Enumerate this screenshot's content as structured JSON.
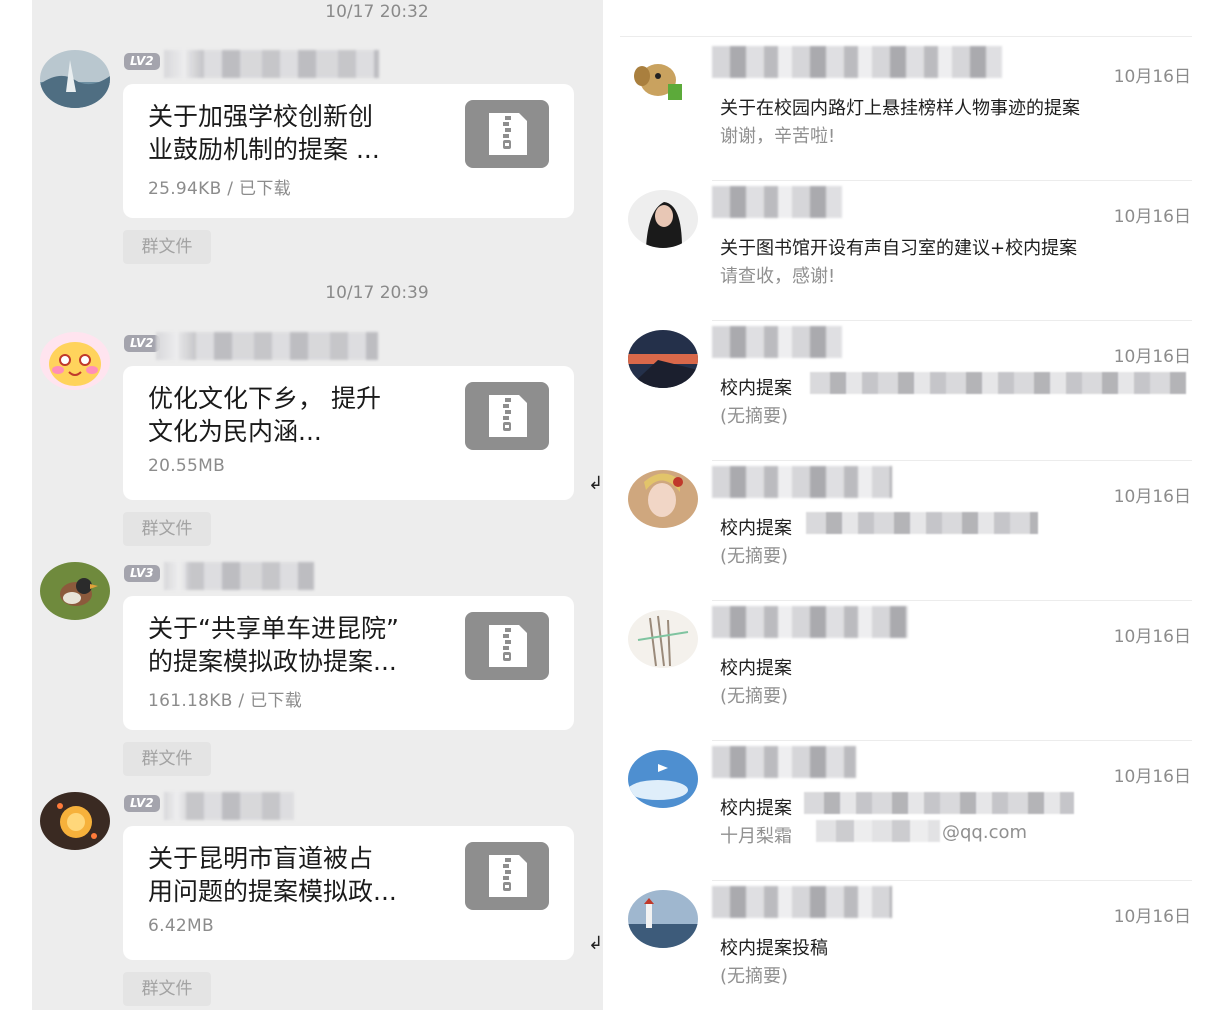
{
  "group_chat": {
    "messages": [
      {
        "timestamp": "10/17 20:32",
        "level": "LV2",
        "file_title": "关于加强学校创新创\n业鼓励机制的提案 ...",
        "file_meta": "25.94KB / 已下载",
        "tag": "群文件",
        "avatar_icon": "landscape-avatar-icon"
      },
      {
        "timestamp": "10/17 20:39",
        "level": "LV2",
        "file_title": "优化文化下乡， 提升\n文化为民内涵...",
        "file_meta": "20.55MB",
        "tag": "群文件",
        "avatar_icon": "cartoon-cat-avatar-icon"
      },
      {
        "level": "LV3",
        "file_title": "关于“共享单车进昆院”\n的提案模拟政协提案...",
        "file_meta": "161.18KB / 已下载",
        "tag": "群文件",
        "avatar_icon": "bird-avatar-icon"
      },
      {
        "level": "LV2",
        "file_title": "关于昆明市盲道被占\n用问题的提案模拟政...",
        "file_meta": "6.42MB",
        "tag": "群文件",
        "avatar_icon": "sun-avatar-icon"
      }
    ]
  },
  "mail_list": {
    "items": [
      {
        "date": "10月16日",
        "subject": "关于在校园内路灯上悬挂榜样人物事迹的提案",
        "summary": "谢谢，辛苦啦!",
        "avatar_icon": "cartoon-elephant-avatar-icon"
      },
      {
        "date": "10月16日",
        "subject": "关于图书馆开设有声自习室的建议+校内提案",
        "summary": "请查收，感谢!",
        "avatar_icon": "person-avatar-icon"
      },
      {
        "date": "10月16日",
        "subject": "校内提案",
        "summary": "(无摘要)",
        "avatar_icon": "sunset-avatar-icon"
      },
      {
        "date": "10月16日",
        "subject": "校内提案",
        "summary": "(无摘要)",
        "avatar_icon": "girl-avatar-icon"
      },
      {
        "date": "10月16日",
        "subject": "校内提案",
        "summary": "(无摘要)",
        "avatar_icon": "sketch-avatar-icon"
      },
      {
        "date": "10月16日",
        "subject": "校内提案",
        "summary": "十月梨霜",
        "summary_tail": "@qq.com",
        "avatar_icon": "sky-avatar-icon"
      },
      {
        "date": "10月16日",
        "subject": "校内提案投稿",
        "summary": "(无摘要)",
        "avatar_icon": "lighthouse-avatar-icon"
      }
    ]
  },
  "colors": {
    "chat_bg": "#ededed",
    "card_bg": "#ffffff",
    "zip_icon_bg": "#8e8e8e",
    "level_badge": "#a4a4ad",
    "muted_text": "#8c8c8c"
  }
}
